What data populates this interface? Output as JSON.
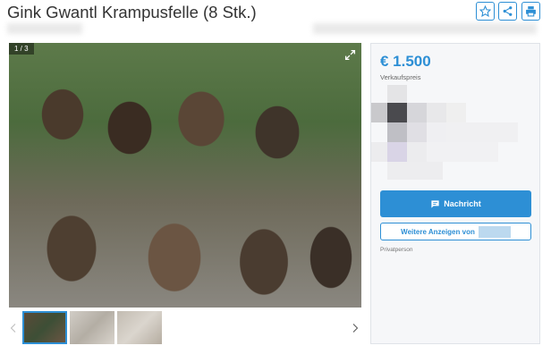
{
  "listing": {
    "title": "Gink Gwantl Krampusfelle (8 Stk.)",
    "price": "€ 1.500",
    "price_label": "Verkaufspreis",
    "seller_type": "Privatperson"
  },
  "gallery": {
    "counter": "1 / 3",
    "current": 1,
    "total": 3
  },
  "actions": {
    "message_label": "Nachricht",
    "more_ads_label": "Weitere Anzeigen von"
  },
  "icons": {
    "favorite": "star-icon",
    "share": "share-icon",
    "print": "print-icon",
    "expand": "expand-icon",
    "message": "chat-icon",
    "prev": "chevron-left-icon",
    "next": "chevron-right-icon"
  },
  "colors": {
    "accent": "#2d8fd5",
    "panel_bg": "#f6f7f9"
  }
}
